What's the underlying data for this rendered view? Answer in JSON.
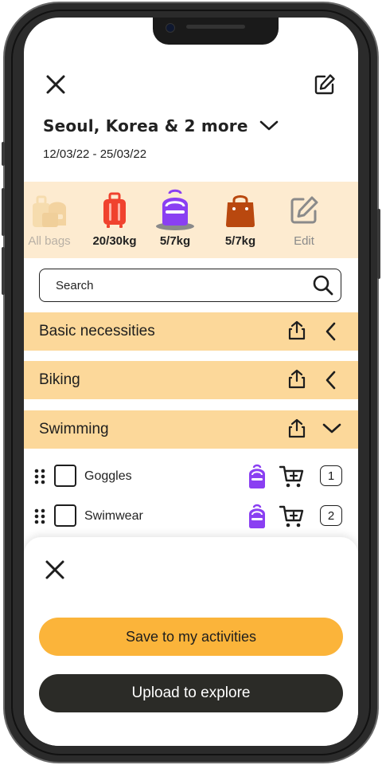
{
  "trip": {
    "title": "Seoul, Korea & 2 more",
    "dates": "12/03/22 - 25/03/22"
  },
  "bags": [
    {
      "label": "All bags",
      "icon": "all-bags-icon",
      "color": "#f4d9a8"
    },
    {
      "label": "20/30kg",
      "icon": "suitcase-icon",
      "color": "#f0422e"
    },
    {
      "label": "5/7kg",
      "icon": "backpack-icon",
      "color": "#8a3ff2",
      "selected": true
    },
    {
      "label": "5/7kg",
      "icon": "handbag-icon",
      "color": "#b9480f"
    },
    {
      "label": "Edit",
      "icon": "edit-icon",
      "color": "#8a8a8a"
    }
  ],
  "search": {
    "placeholder": "Search"
  },
  "categories": [
    {
      "name": "Basic necessities",
      "expanded": false
    },
    {
      "name": "Biking",
      "expanded": false
    },
    {
      "name": "Swimming",
      "expanded": true
    }
  ],
  "items": [
    {
      "name": "Goggles",
      "qty": "1",
      "checked": false
    },
    {
      "name": "Swimwear",
      "qty": "2",
      "checked": false
    }
  ],
  "sheet": {
    "save_label": "Save to my activities",
    "upload_label": "Upload to explore"
  },
  "colors": {
    "accent": "#fbb43a",
    "category_bg": "#fcd89a",
    "bag_strip_bg": "#fdebd0",
    "dark_button": "#2b2b27"
  }
}
